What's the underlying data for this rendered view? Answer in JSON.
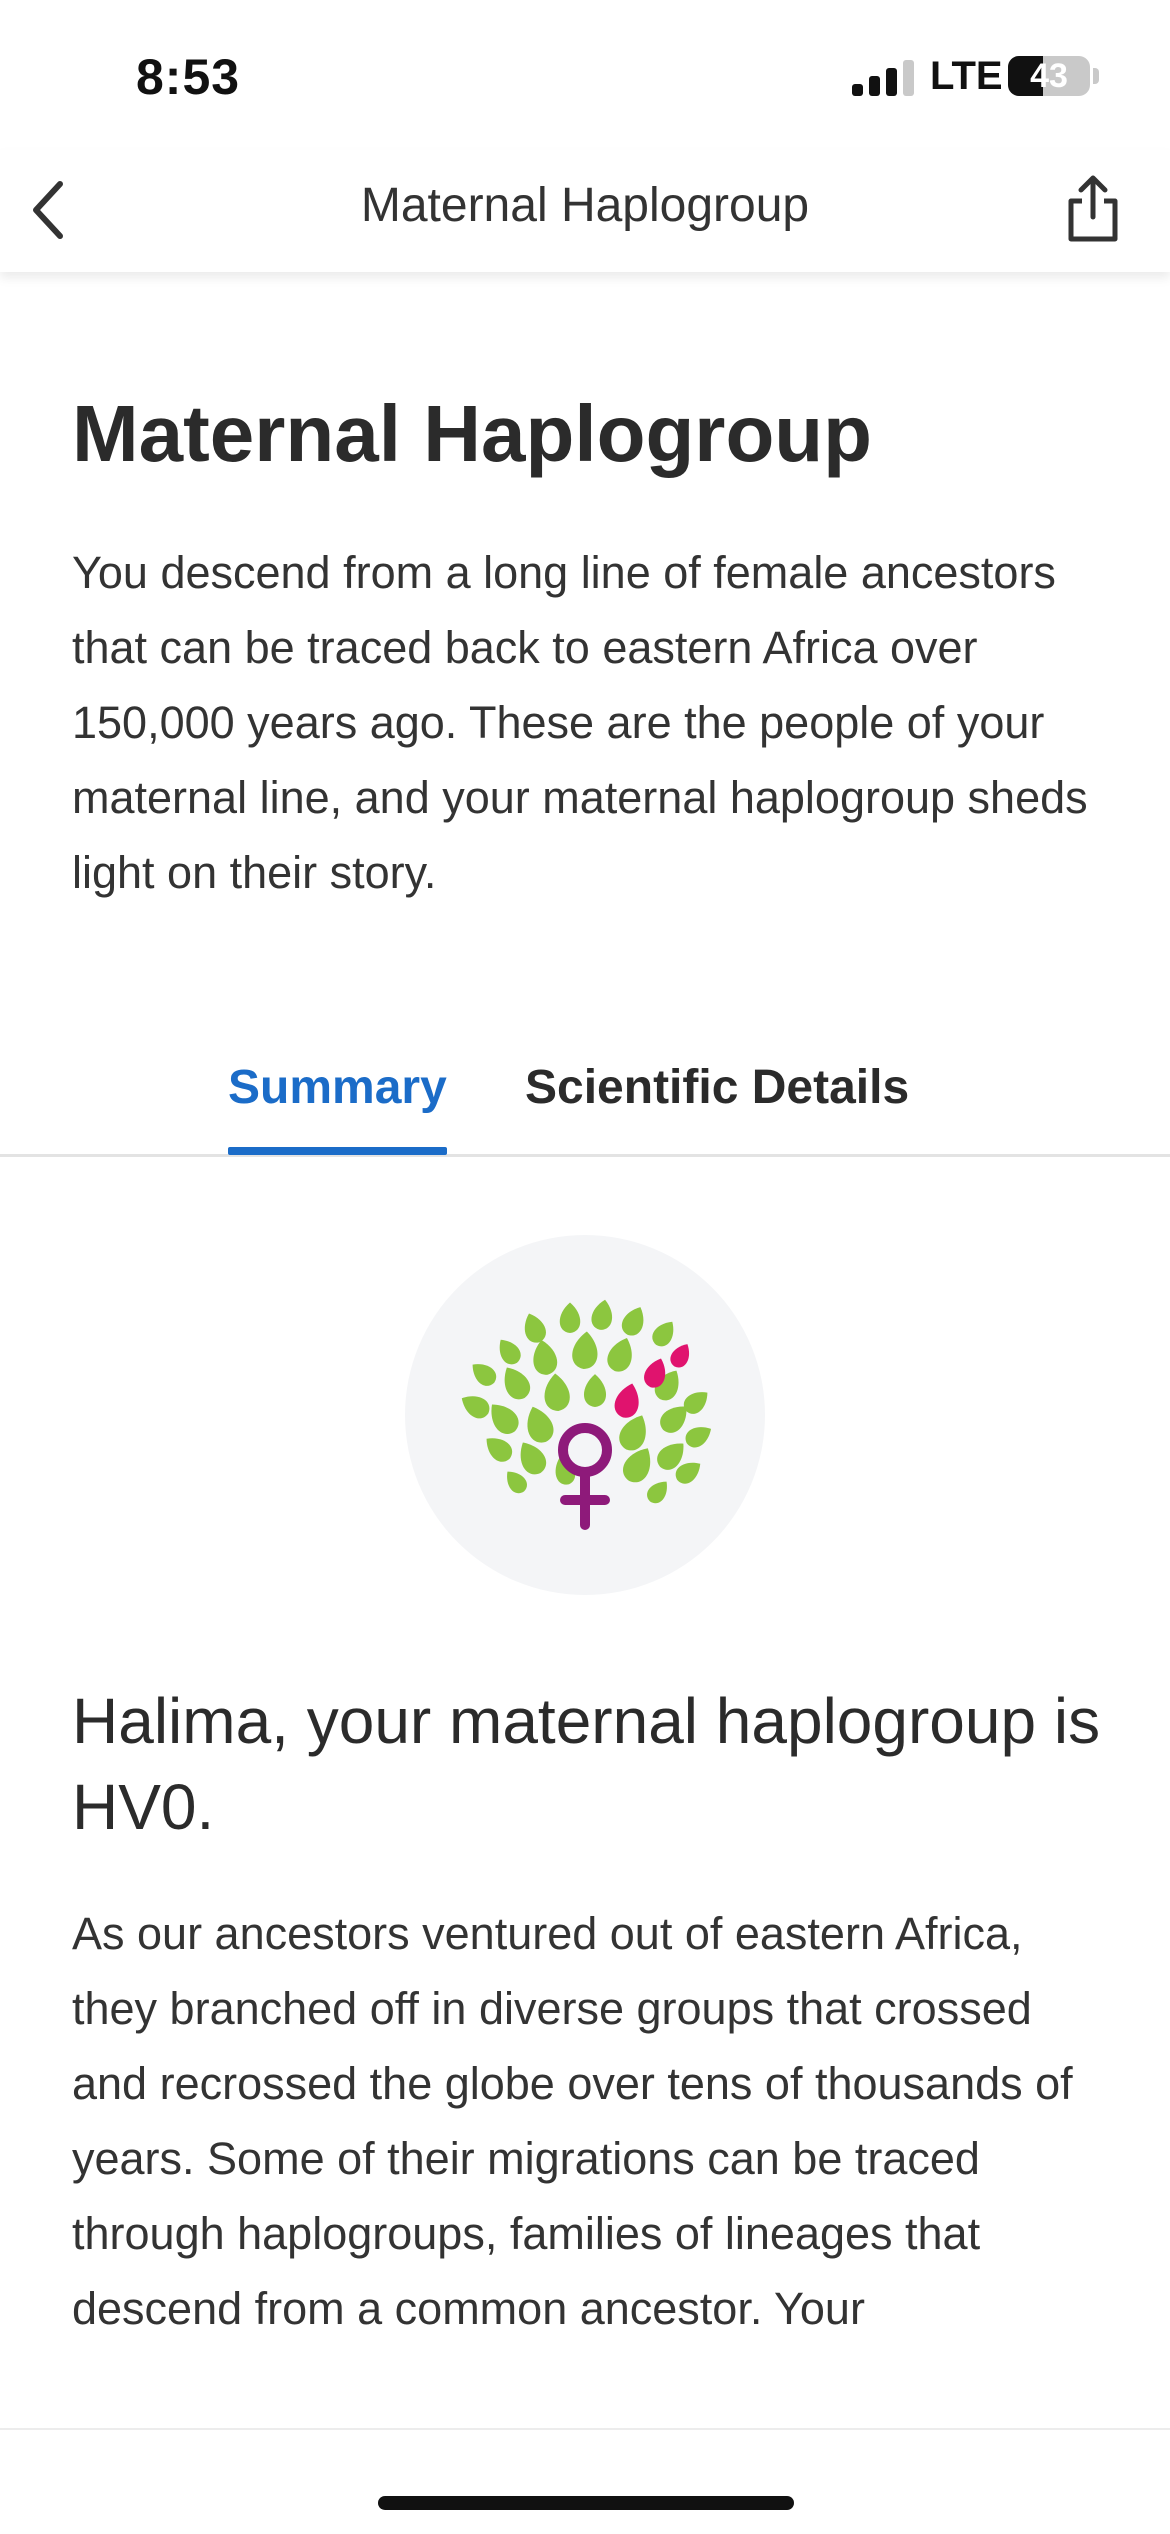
{
  "status_bar": {
    "time": "8:53",
    "network": "LTE",
    "battery": "43",
    "battery_level": 0.43
  },
  "nav": {
    "title": "Maternal Haplogroup"
  },
  "header": {
    "title": "Maternal Haplogroup",
    "intro": "You descend from a long line of female ancestors that can be traced back to eastern Africa over 150,000 years ago. These are the people of your maternal line, and your maternal haplogroup sheds light on their story."
  },
  "tabs": [
    {
      "label": "Summary",
      "active": true
    },
    {
      "label": "Scientific Details",
      "active": false
    }
  ],
  "summary": {
    "icon": "maternal-tree-icon",
    "heading": "Halima, your maternal haplogroup is HV0.",
    "body": "As our ancestors ventured out of eastern Africa, they branched off in diverse groups that crossed and recrossed the globe over tens of thousands of years. Some of their migrations can be traced through haplogroups, families of lineages that descend from a common ancestor. Your"
  },
  "colors": {
    "accent": "#1b6cc8",
    "leaf_green": "#8cc63f",
    "leaf_pink": "#e0136e",
    "symbol_purple": "#8e1a7a"
  }
}
